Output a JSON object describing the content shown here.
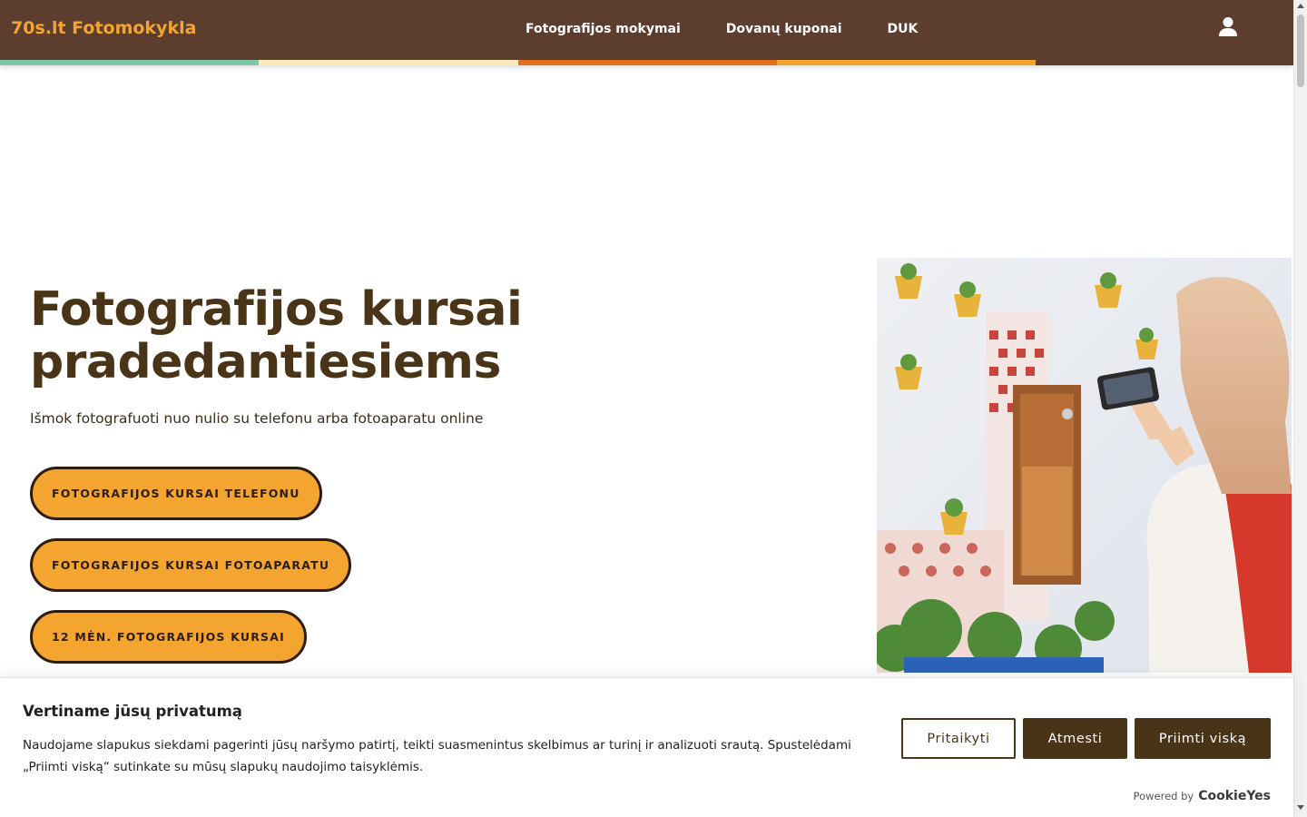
{
  "header": {
    "logo": "70s.lt Fotomokykla",
    "nav": [
      {
        "label": "Fotografijos mokymai"
      },
      {
        "label": "Dovanų kuponai"
      },
      {
        "label": "DUK"
      }
    ],
    "stripe_colors": [
      "#7ec8a9",
      "#fde9b9",
      "#e0701e",
      "#f3a530"
    ],
    "bg_color": "#5c3d2e",
    "logo_color": "#f3a530"
  },
  "hero": {
    "title": "Fotografijos kursai pradedantiesiems",
    "subtitle": "Išmok fotografuoti nuo nulio su telefonu arba fotoaparatu online",
    "buttons": [
      {
        "label": "FOTOGRAFIJOS KURSAI TELEFONU"
      },
      {
        "label": "FOTOGRAFIJOS KURSAI FOTOAPARATU"
      },
      {
        "label": "12 MĖN. FOTOGRAFIJOS KURSAI"
      }
    ],
    "button_color": "#f3a530",
    "title_color": "#4a3418"
  },
  "cookie": {
    "title": "Vertiname jūsų privatumą",
    "text": "Naudojame slapukus siekdami pagerinti jūsų naršymo patirtį, teikti suasmenintus skelbimus ar turinį ir analizuoti srautą. Spustelėdami „Priimti viską“ sutinkate su mūsų slapukų naudojimo taisyklėmis.",
    "customize_label": "Pritaikyti",
    "reject_label": "Atmesti",
    "accept_label": "Priimti viską",
    "powered_label": "Powered by",
    "powered_brand": "CookieYes",
    "button_color": "#4a3418"
  },
  "icons": {
    "user": "user-icon"
  }
}
